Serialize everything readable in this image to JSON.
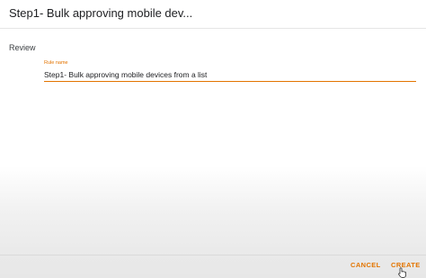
{
  "header": {
    "title": "Step1- Bulk approving mobile dev..."
  },
  "section": {
    "label": "Review"
  },
  "rule_field": {
    "label": "Rule name",
    "value": "Step1- Bulk approving mobile devices from a list"
  },
  "footer": {
    "cancel_label": "CANCEL",
    "create_label": "CREATE"
  },
  "colors": {
    "accent": "#e37400",
    "text": "#202124"
  },
  "icons": {
    "cursor": "hand-pointer-icon"
  }
}
